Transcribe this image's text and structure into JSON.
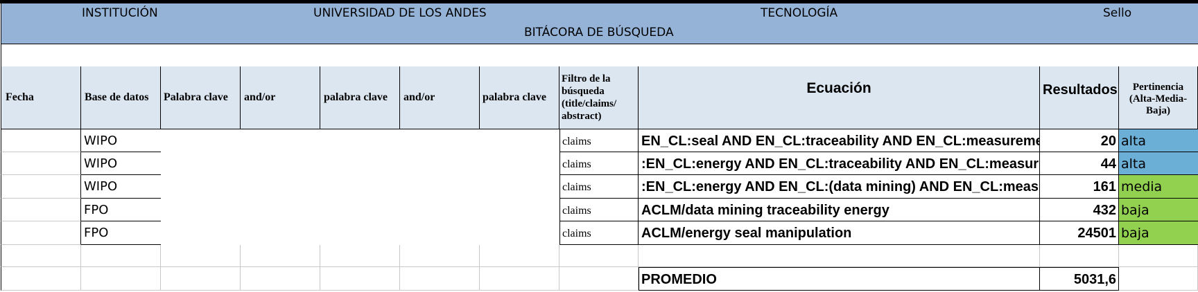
{
  "header": {
    "institucion_label": "INSTITUCIÓN",
    "universidad": "UNIVERSIDAD DE LOS ANDES",
    "tecnologia": "TECNOLOGÍA",
    "sello": "Sello",
    "title": "BITÁCORA DE BÚSQUEDA"
  },
  "columns": {
    "fecha": "Fecha",
    "base": "Base de datos",
    "palabra1": "Palabra clave",
    "andor1": "and/or",
    "palabra2": "palabra clave",
    "andor2": "and/or",
    "palabra3": "palabra clave",
    "filtro": "Filtro de la búsqueda (title/claims/ abstract)",
    "ecuacion": "Ecuación",
    "resultados": "Resultados",
    "pertinencia": "Pertinencia (Alta-Media-Baja)"
  },
  "rows": [
    {
      "base": "WIPO",
      "filtro": "claims",
      "ecuacion": "EN_CL:seal AND EN_CL:traceability AND EN_CL:measurement",
      "resultados": "20",
      "pertinencia": "alta"
    },
    {
      "base": "WIPO",
      "filtro": "claims",
      "ecuacion": ":EN_CL:energy AND EN_CL:traceability AND EN_CL:measurement",
      "resultados": "44",
      "pertinencia": "alta"
    },
    {
      "base": "WIPO",
      "filtro": "claims",
      "ecuacion": ":EN_CL:energy AND EN_CL:(data mining) AND EN_CL:measurement",
      "resultados": "161",
      "pertinencia": "media"
    },
    {
      "base": "FPO",
      "filtro": "claims",
      "ecuacion": "ACLM/data mining traceability energy",
      "resultados": "432",
      "pertinencia": "baja"
    },
    {
      "base": "FPO",
      "filtro": "claims",
      "ecuacion": "ACLM/energy seal manipulation",
      "resultados": "24501",
      "pertinencia": "baja"
    }
  ],
  "summary": {
    "label": "PROMEDIO",
    "value": "5031,6"
  },
  "colors": {
    "header_bg": "#95b3d7",
    "col_header_bg": "#dce6f1",
    "alta": "#6baed6",
    "media_baja": "#92d050"
  }
}
